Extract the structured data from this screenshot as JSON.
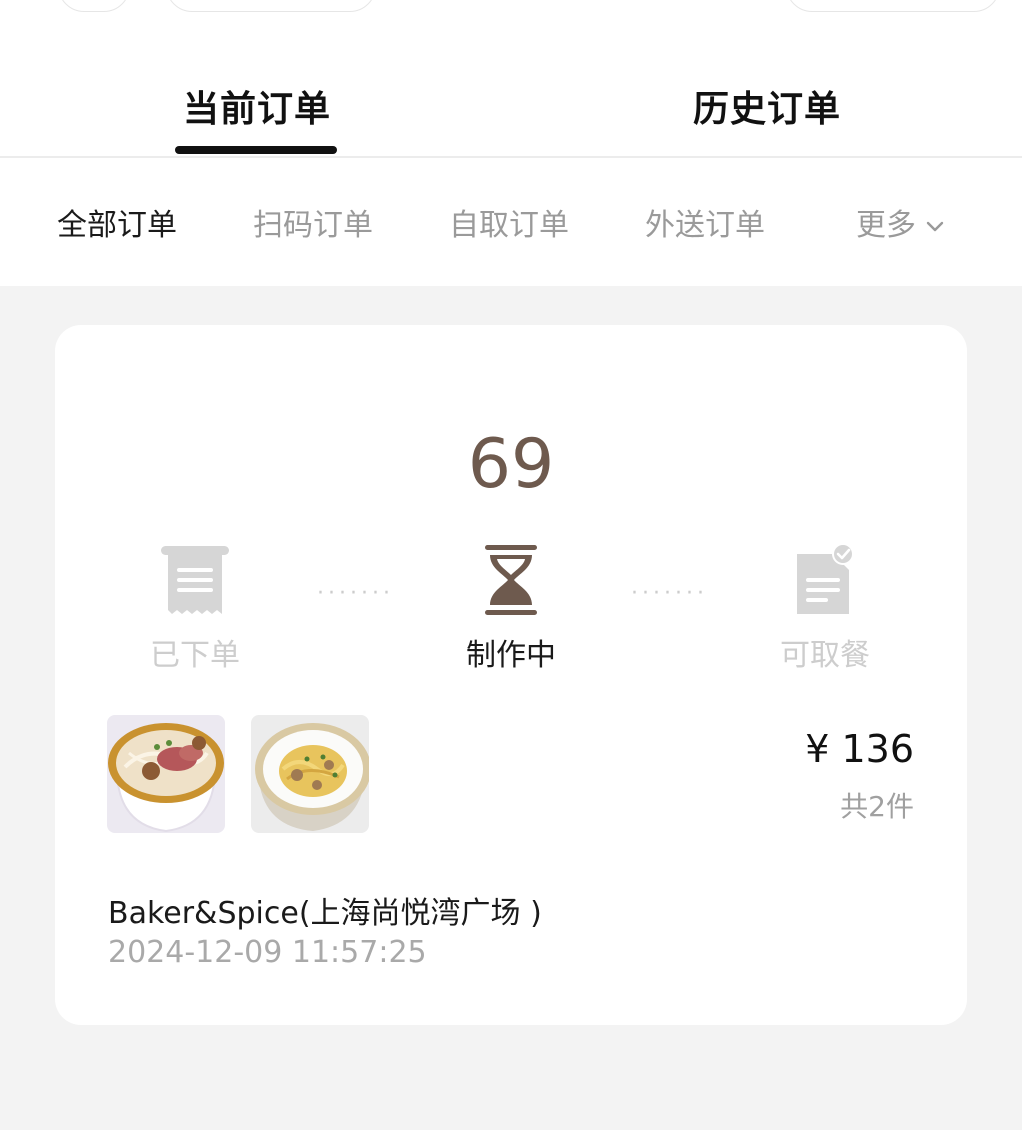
{
  "tabs": {
    "current": "当前订单",
    "history": "历史订单"
  },
  "filters": [
    {
      "label": "全部订单",
      "active": true
    },
    {
      "label": "扫码订单",
      "active": false
    },
    {
      "label": "自取订单",
      "active": false
    },
    {
      "label": "外送订单",
      "active": false
    },
    {
      "label": "更多",
      "active": false
    }
  ],
  "order": {
    "number": "69",
    "steps": [
      {
        "label": "已下单",
        "icon": "receipt-icon",
        "state": "done"
      },
      {
        "label": "制作中",
        "icon": "hourglass-icon",
        "state": "current"
      },
      {
        "label": "可取餐",
        "icon": "ready-document-icon",
        "state": "pending"
      }
    ],
    "price": "¥ 136",
    "item_count": "共2件",
    "store": "Baker&Spice(上海尚悦湾广场 )",
    "time": "2024-12-09 11:57:25",
    "items": [
      {
        "icon": "beef-noodle-soup-image"
      },
      {
        "icon": "pasta-bowl-image"
      }
    ]
  },
  "colors": {
    "accent_brown": "#6e5a4e",
    "inactive_gray": "#cdcdcd",
    "background": "#f3f3f3"
  }
}
